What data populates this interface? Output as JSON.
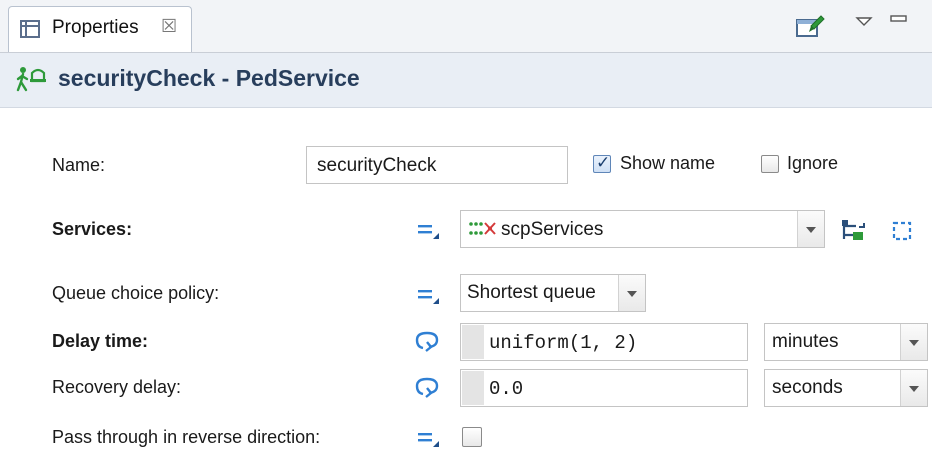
{
  "tab": {
    "label": "Properties",
    "close_symbol": "☒"
  },
  "header": {
    "title": "securityCheck - PedService"
  },
  "form": {
    "name_label": "Name:",
    "name_value": "securityCheck",
    "show_name_label": "Show name",
    "show_name_checked": true,
    "ignore_label": "Ignore",
    "ignore_checked": false,
    "services_label": "Services:",
    "services_value": "scpServices",
    "queue_label": "Queue choice policy:",
    "queue_value": "Shortest queue",
    "delay_label": "Delay time:",
    "delay_value": "uniform(1, 2)",
    "delay_unit": "minutes",
    "recovery_label": "Recovery delay:",
    "recovery_value": "0.0",
    "recovery_unit": "seconds",
    "pass_label": "Pass through in reverse direction:",
    "pass_checked": false
  },
  "icons": {
    "tab": "properties-view-icon",
    "toolbar": [
      "pin-to-selection-icon",
      "view-menu-icon",
      "minimize-icon"
    ],
    "header": "ped-service-icon",
    "static_mode": "static-value-icon",
    "dynamic_mode": "dynamic-value-icon",
    "services_actions": [
      "select-in-graph-icon",
      "select-area-icon"
    ]
  },
  "colors": {
    "accent": "#2f7fd3",
    "header_text": "#283e5c",
    "header_bg": "#e9eef5",
    "icon_green": "#2e9a3a"
  }
}
